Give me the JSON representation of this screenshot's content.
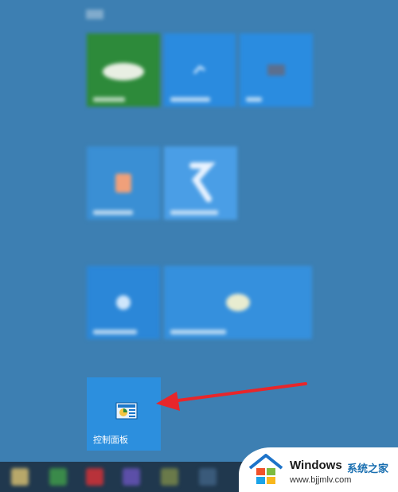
{
  "start_screen": {
    "control_panel_tile": {
      "label": "控制面板",
      "icon": "control-panel-icon"
    }
  },
  "annotation": {
    "arrow_color": "#e8262a",
    "points_to": "control-panel-tile"
  },
  "watermark": {
    "title": "Windows",
    "subtitle": "系统之家",
    "url": "www.bjjmlv.com"
  }
}
